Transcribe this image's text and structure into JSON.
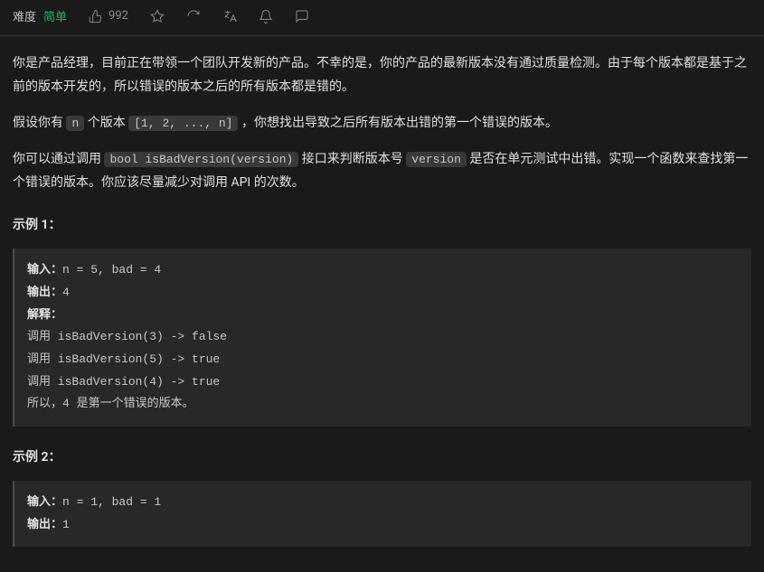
{
  "header": {
    "difficulty_label": "难度",
    "difficulty_value": "简单",
    "likes": "992"
  },
  "problem": {
    "p1": "你是产品经理，目前正在带领一个团队开发新的产品。不幸的是，你的产品的最新版本没有通过质量检测。由于每个版本都是基于之前的版本开发的，所以错误的版本之后的所有版本都是错的。",
    "p2_a": "假设你有 ",
    "p2_code1": "n",
    "p2_b": " 个版本 ",
    "p2_code2": "[1, 2, ..., n]",
    "p2_c": " ，你想找出导致之后所有版本出错的第一个错误的版本。",
    "p3_a": "你可以通过调用 ",
    "p3_code1": "bool isBadVersion(version)",
    "p3_b": " 接口来判断版本号 ",
    "p3_code2": "version",
    "p3_c": " 是否在单元测试中出错。实现一个函数来查找第一个错误的版本。你应该尽量减少对调用 API 的次数。"
  },
  "examples": {
    "title1": "示例 1：",
    "ex1": {
      "input_label": "输入：",
      "input_val": "n = 5, bad = 4",
      "output_label": "输出：",
      "output_val": "4",
      "explain_label": "解释：",
      "body": "调用 isBadVersion(3) -> false \n调用 isBadVersion(5) -> true \n调用 isBadVersion(4) -> true\n所以，4 是第一个错误的版本。"
    },
    "title2": "示例 2：",
    "ex2": {
      "input_label": "输入：",
      "input_val": "n = 1, bad = 1",
      "output_label": "输出：",
      "output_val": "1"
    }
  }
}
